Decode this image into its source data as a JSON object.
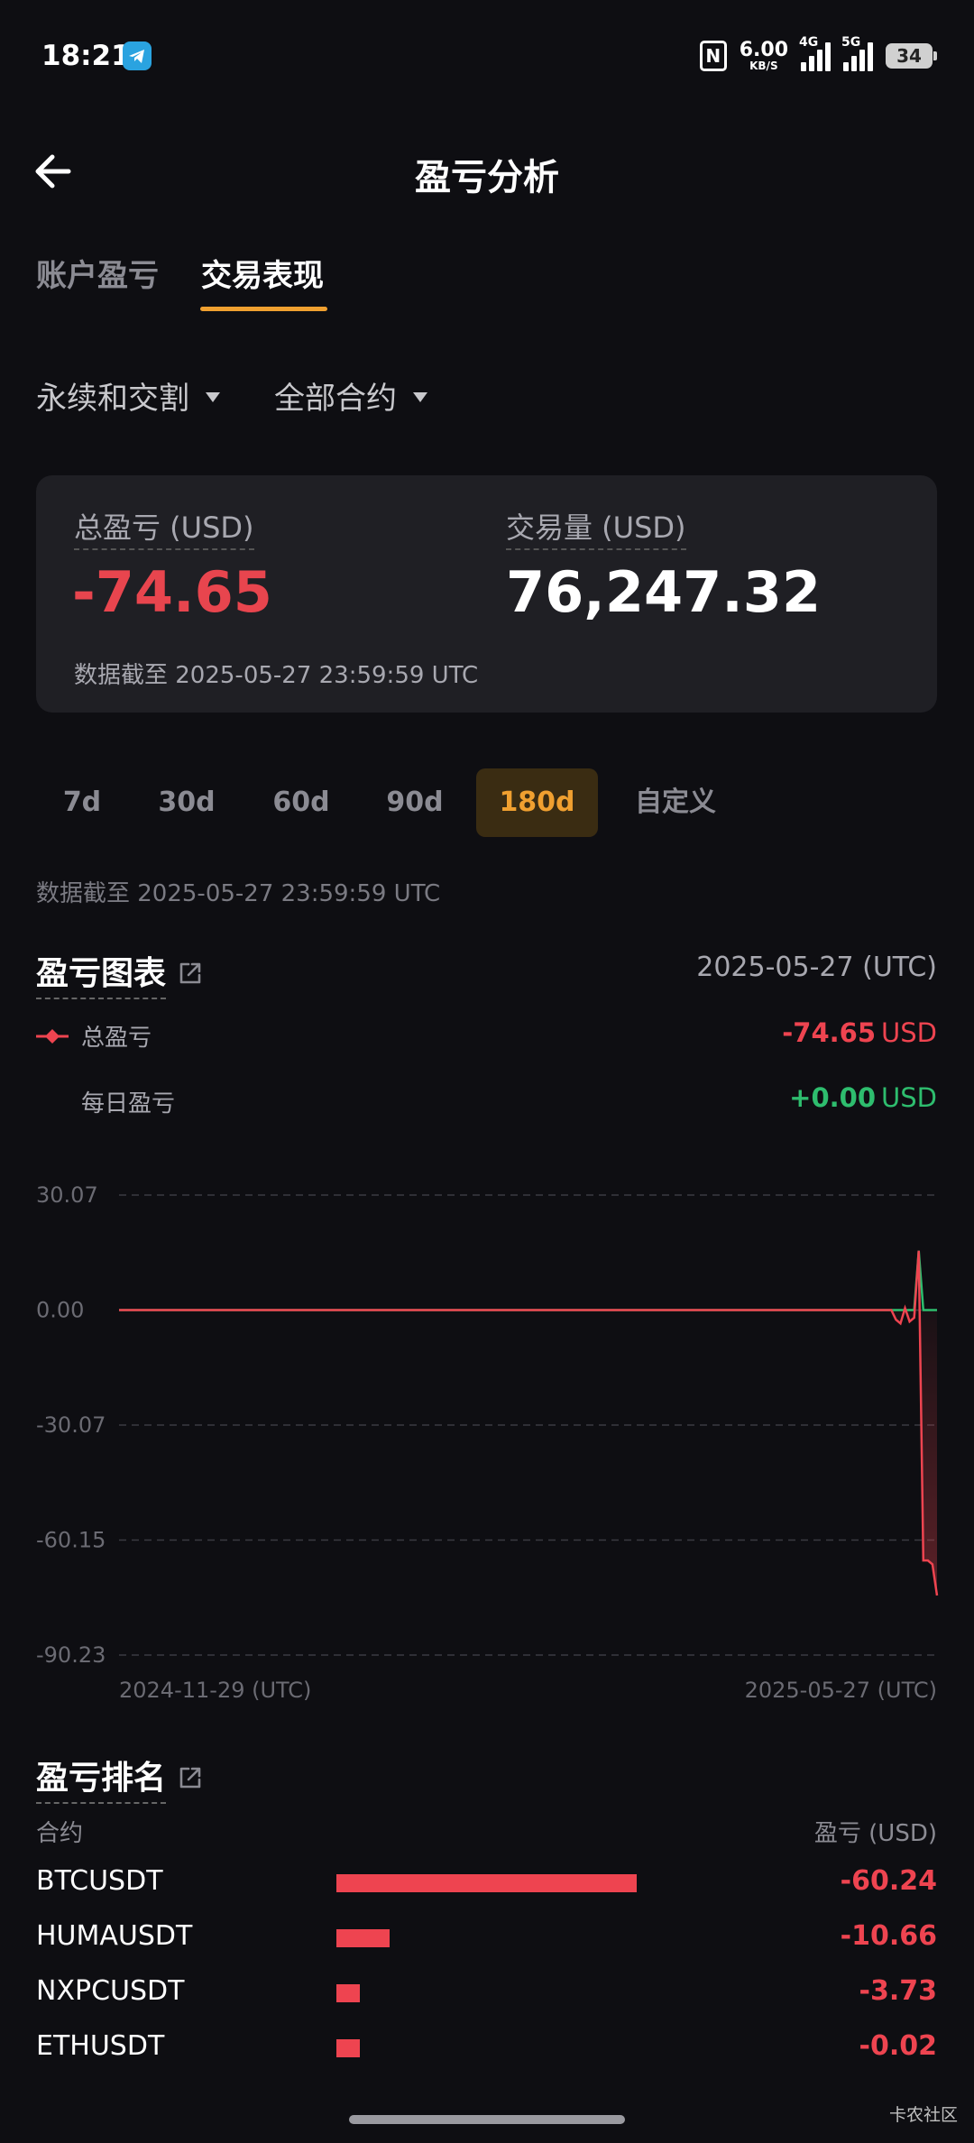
{
  "status_bar": {
    "time": "18:21",
    "nfc_label": "N",
    "net_speed": "6.00",
    "net_speed_unit": "KB/S",
    "signal1_label": "4G",
    "signal2_label": "5G",
    "battery": "34",
    "icons": [
      "telegram-icon",
      "nfc-icon",
      "signal-icon",
      "battery-icon"
    ]
  },
  "header": {
    "title": "盈亏分析",
    "back_icon": "arrow-left-icon"
  },
  "tabs": [
    {
      "label": "账户盈亏",
      "active": false
    },
    {
      "label": "交易表现",
      "active": true
    }
  ],
  "filters": {
    "type": "永续和交割",
    "contract": "全部合约"
  },
  "summary": {
    "pnl_label": "总盈亏 (USD)",
    "pnl_value": "-74.65",
    "volume_label": "交易量 (USD)",
    "volume_value": "76,247.32",
    "note": "数据截至 2025-05-27 23:59:59 UTC"
  },
  "periods": [
    {
      "label": "7d",
      "active": false
    },
    {
      "label": "30d",
      "active": false
    },
    {
      "label": "60d",
      "active": false
    },
    {
      "label": "90d",
      "active": false
    },
    {
      "label": "180d",
      "active": true
    },
    {
      "label": "自定义",
      "active": false
    }
  ],
  "period_note": "数据截至 2025-05-27 23:59:59 UTC",
  "pnl_chart": {
    "title": "盈亏图表",
    "date": "2025-05-27 (UTC)",
    "legend": [
      {
        "label": "总盈亏",
        "value": "-74.65",
        "unit": "USD",
        "color": "#ee4450"
      },
      {
        "label": "每日盈亏",
        "value": "+0.00",
        "unit": "USD",
        "color": "#2ebd6e"
      }
    ]
  },
  "chart_data": {
    "type": "line",
    "title": "盈亏图表",
    "xlabel": "",
    "ylabel": "",
    "x_start": "2024-11-29 (UTC)",
    "x_end": "2025-05-27 (UTC)",
    "y_ticks": [
      "30.07",
      "0.00",
      "-30.07",
      "-60.15",
      "-90.23"
    ],
    "ylim": [
      -90.23,
      30.07
    ],
    "grid": true,
    "series": [
      {
        "name": "总盈亏",
        "color": "#ee4450",
        "x": [
          "2024-11-29",
          "2025-05-14",
          "2025-05-17",
          "2025-05-18",
          "2025-05-19",
          "2025-05-20",
          "2025-05-21",
          "2025-05-22",
          "2025-05-23",
          "2025-05-24",
          "2025-05-25",
          "2025-05-26",
          "2025-05-27"
        ],
        "values": [
          0.0,
          0.0,
          0.0,
          -2.5,
          -3.5,
          0.5,
          -3.0,
          -2.0,
          15.5,
          -65.5,
          -65.5,
          -66.5,
          -74.65
        ]
      },
      {
        "name": "每日盈亏",
        "color": "#2ebd6e",
        "x": [
          "2024-11-29",
          "2025-05-22",
          "2025-05-23",
          "2025-05-24",
          "2025-05-27"
        ],
        "values": [
          0.0,
          0.0,
          15.5,
          0.0,
          0.0
        ]
      }
    ]
  },
  "ranking": {
    "title": "盈亏排名",
    "col_contract": "合约",
    "col_pnl": "盈亏 (USD)",
    "rows": [
      {
        "name": "BTCUSDT",
        "value": "-60.24",
        "magnitude": 60.24
      },
      {
        "name": "HUMAUSDT",
        "value": "-10.66",
        "magnitude": 10.66
      },
      {
        "name": "NXPCUSDT",
        "value": "-3.73",
        "magnitude": 3.73
      },
      {
        "name": "ETHUSDT",
        "value": "-0.02",
        "magnitude": 0.02
      }
    ]
  },
  "watermark": "卡农社区"
}
